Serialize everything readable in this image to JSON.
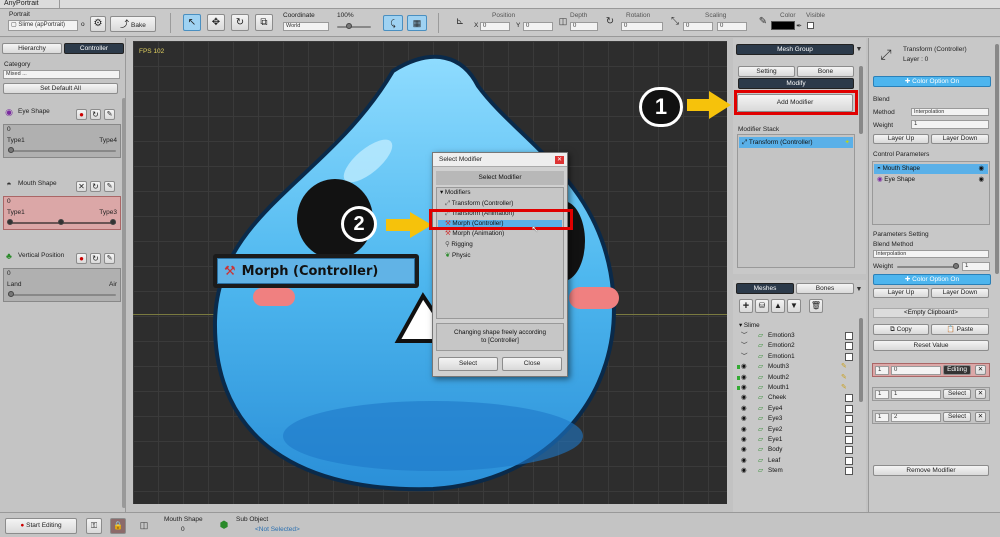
{
  "app": {
    "title": "AnyPortrait"
  },
  "toolbar": {
    "portrait_label": "Portrait",
    "portrait_value": "Slime (apPortrait)",
    "o_label": "o",
    "bake_label": "Bake",
    "coordinate_label": "Coordinate",
    "coordinate_value": "World",
    "zoom": "100%",
    "position_label": "Position",
    "x_label": "X",
    "y_label": "Y",
    "pos_x": "0",
    "pos_y": "0",
    "depth_label": "Depth",
    "depth_value": "0",
    "rotation_label": "Rotation",
    "rotation_value": "0",
    "scaling_label": "Scaling",
    "scale_x": "0",
    "scale_y": "0",
    "color_label": "Color",
    "visible_label": "Visible"
  },
  "left": {
    "tab_hierarchy": "Hierarchy",
    "tab_controller": "Controller",
    "category_label": "Category",
    "category_value": "Mixed ...",
    "set_default": "Set Default All",
    "params": [
      {
        "name": "Eye Shape",
        "value": "0",
        "min": "Type1",
        "max": "Type4"
      },
      {
        "name": "Mouth Shape",
        "value": "0",
        "min": "Type1",
        "max": "Type3"
      },
      {
        "name": "Vertical Position",
        "value": "0",
        "min": "Land",
        "max": "Air"
      }
    ]
  },
  "viewport": {
    "fps": "FPS 102",
    "callout_label": "Morph (Controller)",
    "step1": "1",
    "step2": "2"
  },
  "dialog": {
    "title": "Select Modifier",
    "header": "Select Modifier",
    "root": "Modifiers",
    "items": [
      "Transform (Controller)",
      "Transform (Animation)",
      "Morph (Controller)",
      "Morph (Animation)",
      "Rigging",
      "Physic"
    ],
    "description": "Changing shape freely according to [Controller]",
    "select": "Select",
    "close": "Close"
  },
  "mesh_panel": {
    "mesh_group": "Mesh Group",
    "setting": "Setting",
    "bone": "Bone",
    "modify": "Modify",
    "add_modifier": "Add Modifier",
    "modifier_stack_label": "Modifier Stack",
    "modifier_item": "Transform (Controller)"
  },
  "list_panel": {
    "tab_meshes": "Meshes",
    "tab_bones": "Bones",
    "root": "Slime",
    "items": [
      "Emotion3",
      "Emotion2",
      "Emotion1",
      "Mouth3",
      "Mouth2",
      "Mouth1",
      "Cheek",
      "Eye4",
      "Eye3",
      "Eye2",
      "Eye1",
      "Body",
      "Leaf",
      "Stem"
    ]
  },
  "right": {
    "title": "Transform (Controller)",
    "layer": "Layer : 0",
    "color_option": "Color Option On",
    "blend_label": "Blend",
    "method_label": "Method",
    "method_value": "Interpolation",
    "weight_label": "Weight",
    "weight_value": "1",
    "layer_up": "Layer Up",
    "layer_down": "Layer Down",
    "control_params_label": "Control Parameters",
    "cp_items": [
      "Mouth Shape",
      "Eye Shape"
    ],
    "params_setting_label": "Parameters Setting",
    "blend_method_label": "Blend Method",
    "blend_method_value": "Interpolation",
    "weight2_label": "Weight",
    "weight2_value": "1",
    "color_option2": "Color Option On",
    "layer_up2": "Layer Up",
    "layer_down2": "Layer Down",
    "clipboard": "<Empty Clipboard>",
    "copy": "Copy",
    "paste": "Paste",
    "reset_value": "Reset Value",
    "rows": [
      {
        "a": "1",
        "b": "0",
        "btn": "Editing"
      },
      {
        "a": "1",
        "b": "1",
        "btn": "Select"
      },
      {
        "a": "1",
        "b": "2",
        "btn": "Select"
      }
    ],
    "remove_modifier": "Remove Modifier"
  },
  "bottom": {
    "start_editing": "Start Editing",
    "param_name": "Mouth Shape",
    "param_value": "0",
    "sub_object_label": "Sub Object",
    "sub_object_value": "<Not Selected>"
  },
  "colors": {
    "accent": "#51a7e0",
    "highlight_red": "#e00000",
    "arrow_yellow": "#f6c20b",
    "slime_blue": "#4fb8ef",
    "viewport_bg": "#2d2d2d"
  }
}
